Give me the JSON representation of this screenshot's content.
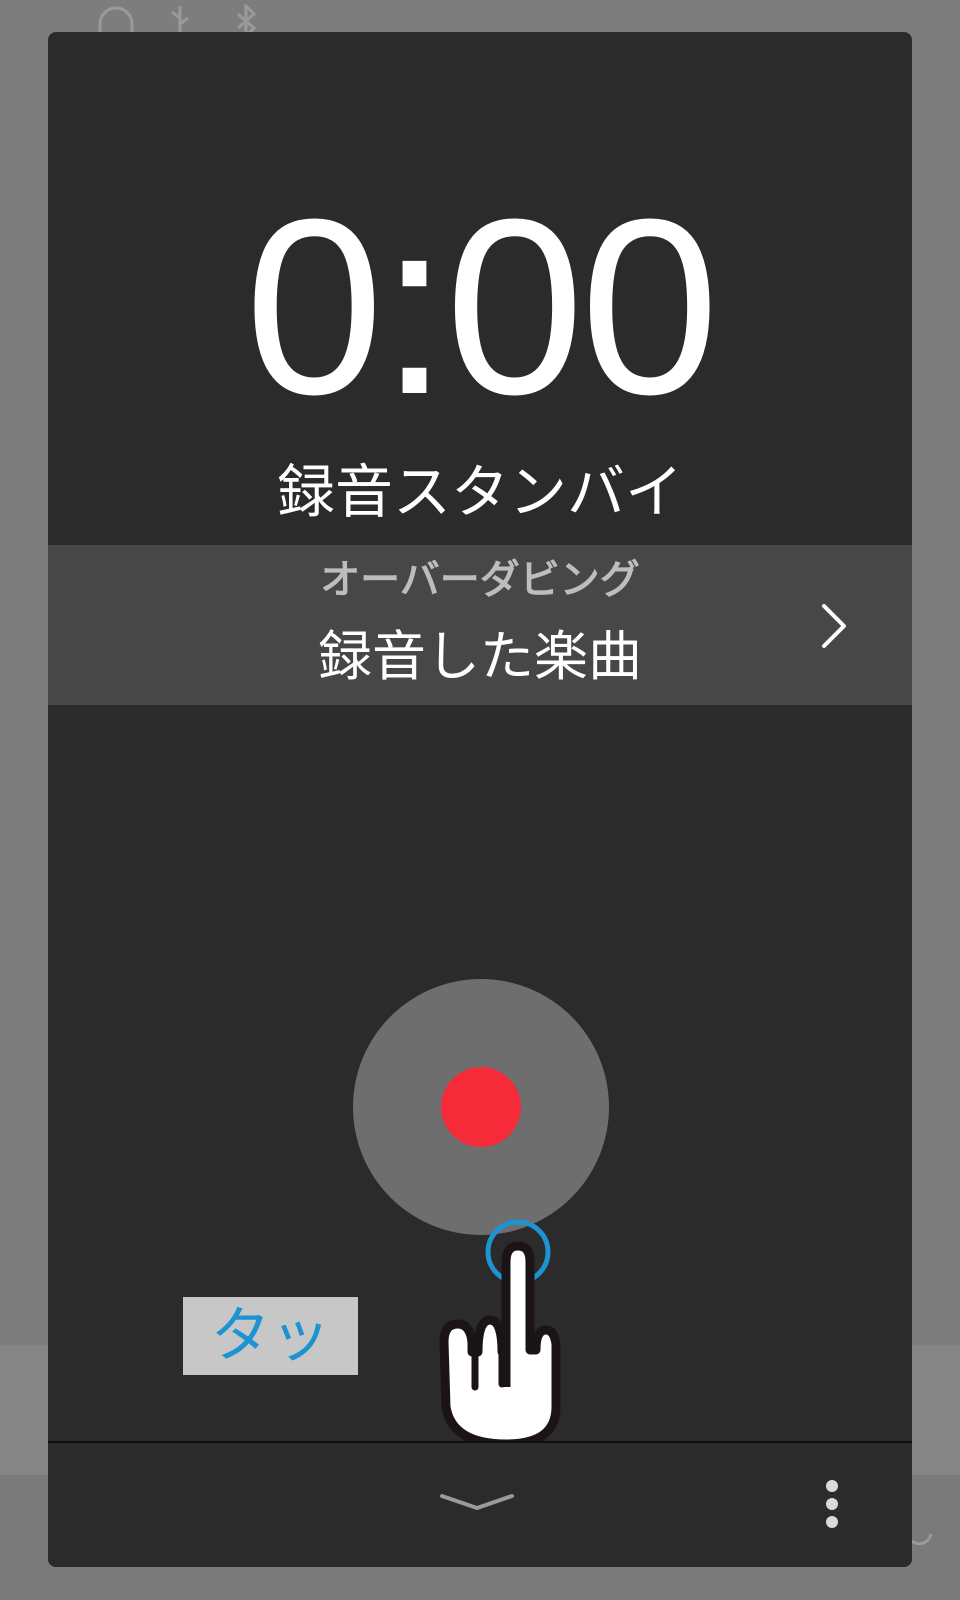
{
  "status_bar": {
    "icons": [
      "headphones-icon",
      "usb-icon",
      "bluetooth-icon"
    ]
  },
  "recorder": {
    "time": "0:00",
    "status": "録音スタンバイ"
  },
  "song": {
    "mode": "オーバーダビング",
    "name": "録音した楽曲",
    "chevron_icon": "chevron-right-icon"
  },
  "record_button": {
    "icon": "record-icon",
    "color": "#f52b3a"
  },
  "hint": {
    "label": "タップ",
    "color": "#1d93d2",
    "icon": "tap-hand-icon"
  },
  "bottom_bar": {
    "collapse_icon": "chevron-down-icon",
    "menu_icon": "more-vert-icon"
  },
  "colors": {
    "panel": "#2b2b2b",
    "song_row": "#474747",
    "record_outer": "#6e6e6e",
    "record_dot": "#f52b3a"
  }
}
